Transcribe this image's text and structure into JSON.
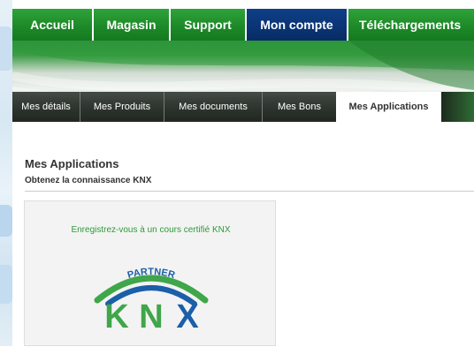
{
  "top_nav": {
    "items": [
      {
        "label": "Accueil"
      },
      {
        "label": "Magasin"
      },
      {
        "label": "Support"
      },
      {
        "label": "Mon compte",
        "active": true
      },
      {
        "label": "Téléchargements"
      }
    ],
    "color": "#1d8a28",
    "active_color": "#0a3474"
  },
  "sub_tabs": {
    "items": [
      {
        "label": "Mes détails"
      },
      {
        "label": "Mes Produits"
      },
      {
        "label": "Mes documents"
      },
      {
        "label": "Mes Bons"
      },
      {
        "label": "Mes Applications",
        "active": true
      }
    ]
  },
  "content": {
    "title": "Mes Applications",
    "subtitle": "Obtenez la connaissance KNX",
    "card": {
      "cta": "Enregistrez-vous à un cours certifié KNX",
      "logo": {
        "arc_text": "PARTNER",
        "letters": [
          "K",
          "N",
          "X"
        ],
        "green": "#3fa64a",
        "blue": "#1a5fa8"
      }
    }
  }
}
